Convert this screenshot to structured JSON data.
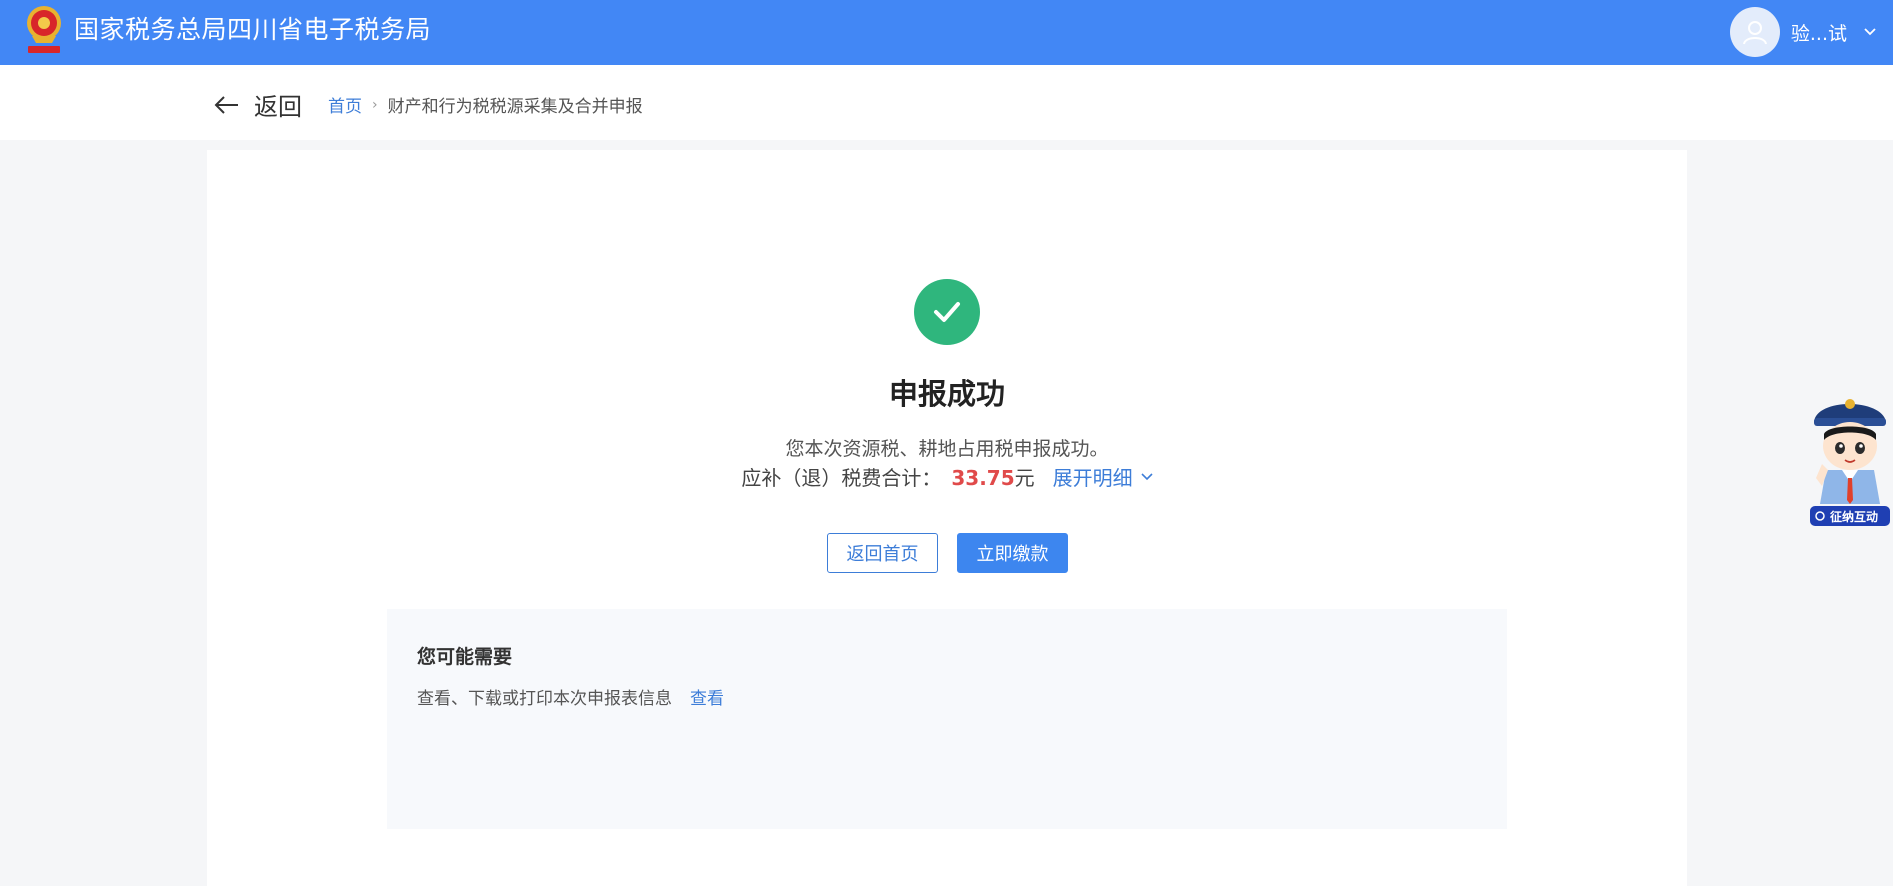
{
  "header": {
    "brand_title": "国家税务总局四川省电子税务局",
    "username": "验...试",
    "accent_color": "#4287f5",
    "logo_icon": "tax-emblem-icon",
    "avatar_icon": "user-avatar-icon"
  },
  "nav": {
    "back_label": "返回",
    "breadcrumb": {
      "home": "首页",
      "current": "财产和行为税税源采集及合并申报"
    }
  },
  "result": {
    "status_icon": "check-circle-icon",
    "status_color": "#2fb67d",
    "title": "申报成功",
    "description": "您本次资源税、耕地占用税申报成功。",
    "amount_label": "应补（退）税费合计：",
    "amount_value": "33.75",
    "amount_unit": "元",
    "amount_color": "#e04a4a",
    "expand_label": "展开明细"
  },
  "actions": {
    "back_home_label": "返回首页",
    "pay_now_label": "立即缴款"
  },
  "suggestions": {
    "heading": "您可能需要",
    "items": [
      {
        "text": "查看、下载或打印本次申报表信息",
        "link": "查看"
      }
    ]
  },
  "assistant": {
    "badge_text": "征纳互动",
    "icon": "tax-officer-mascot-icon"
  }
}
